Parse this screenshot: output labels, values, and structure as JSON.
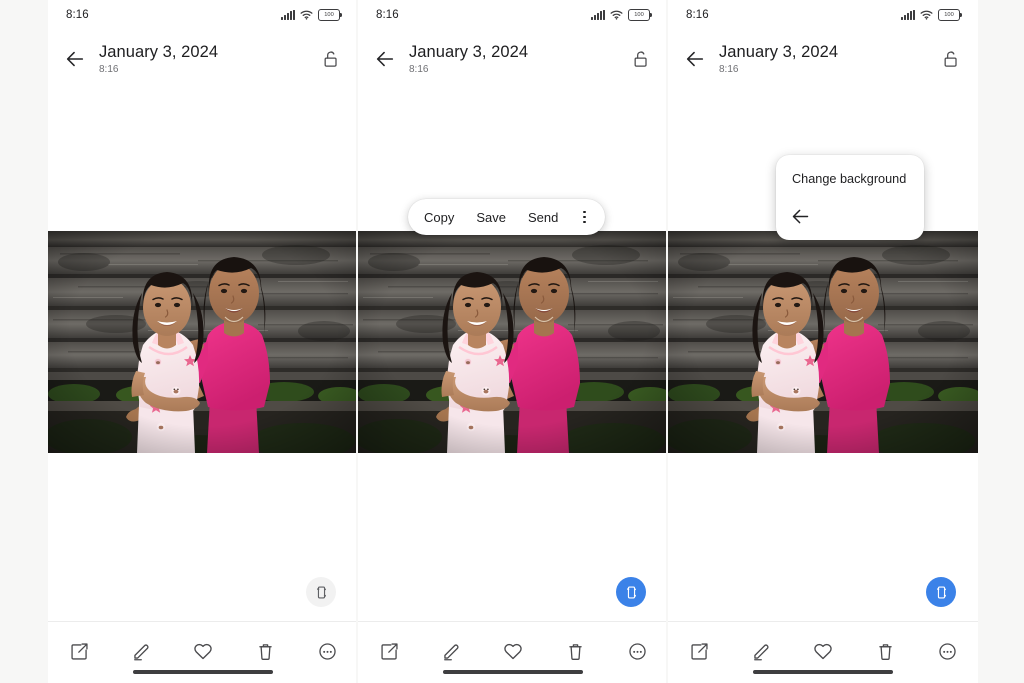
{
  "page": {
    "background_color": "#f7f7f6",
    "panel_background": "#ffffff",
    "accent_color": "#3b82e8"
  },
  "status_bar": {
    "clock": "8:16",
    "signal_icon": "signal-bars-icon",
    "wifi_icon": "wifi-icon",
    "battery_icon": "battery-icon",
    "battery_level": "100"
  },
  "app_bar": {
    "back_icon": "back-arrow-icon",
    "title": "January 3, 2024",
    "subtitle": "8:16",
    "lock_icon": "unlock-icon"
  },
  "photo": {
    "alt": "Two smiling girls embracing in front of a weathered grey wooden wall"
  },
  "context_menu": {
    "items": [
      {
        "label": "Copy",
        "name": "context-menu-copy"
      },
      {
        "label": "Save",
        "name": "context-menu-save"
      },
      {
        "label": "Send",
        "name": "context-menu-send"
      }
    ],
    "overflow_icon": "kebab-menu-icon"
  },
  "background_popup": {
    "label": "Change background",
    "back_icon": "back-arrow-icon"
  },
  "lens_button": {
    "icon": "google-lens-icon",
    "states": [
      "inactive",
      "active",
      "active"
    ],
    "active_color": "#3b82e8",
    "inactive_color": "#f2f2f2"
  },
  "toolbar": {
    "items": [
      {
        "label": "Share",
        "icon": "share-icon"
      },
      {
        "label": "Edit",
        "icon": "pencil-icon"
      },
      {
        "label": "Favorite",
        "icon": "heart-icon"
      },
      {
        "label": "Delete",
        "icon": "trash-icon"
      },
      {
        "label": "More",
        "icon": "more-circle-icon"
      }
    ]
  },
  "panels": [
    {
      "id": "panel-0",
      "name": "screenshot-panel-1"
    },
    {
      "id": "panel-1",
      "name": "screenshot-panel-2"
    },
    {
      "id": "panel-2",
      "name": "screenshot-panel-3"
    }
  ]
}
